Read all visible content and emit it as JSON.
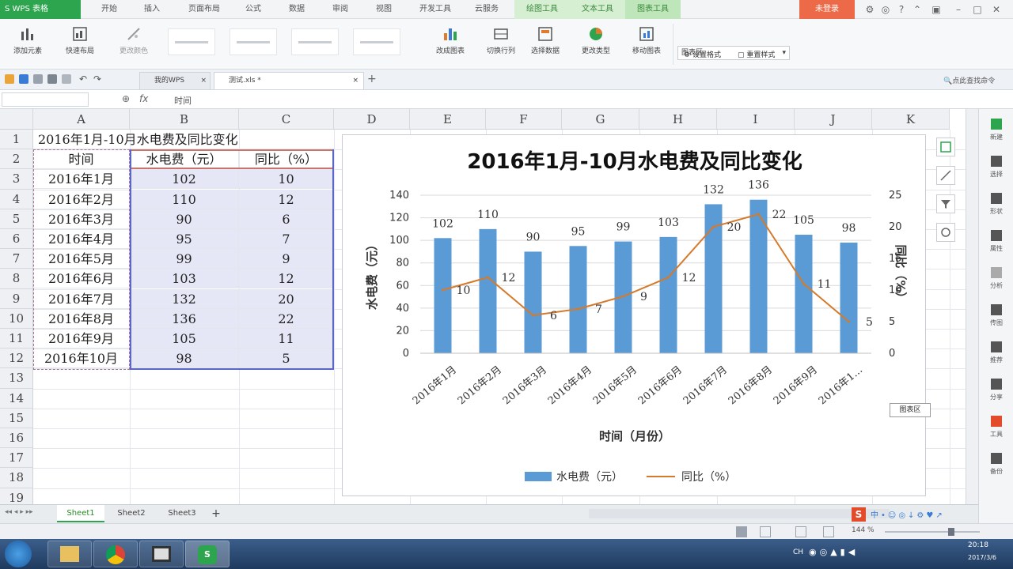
{
  "titlebar": {
    "app_button": "S WPS 表格",
    "tabs": [
      "开始",
      "插入",
      "页面布局",
      "公式",
      "数据",
      "审阅",
      "视图",
      "开发工具",
      "云服务"
    ],
    "context_tabs": [
      "绘图工具",
      "文本工具",
      "图表工具"
    ],
    "login": "未登录"
  },
  "ribbon": {
    "left_buttons": [
      "添加元素",
      "快速布局",
      "更改颜色"
    ],
    "right_buttons": [
      "改成图表",
      "切换行列",
      "选择数据",
      "更改类型",
      "移动图表"
    ],
    "element_select": "图表区",
    "format_buttons": [
      "设置格式",
      "重置样式"
    ]
  },
  "quickbar": {
    "tab1": "我的WPS",
    "tab2": "测试.xls *",
    "search": "点此查找命令"
  },
  "formula": {
    "fx": "fx",
    "content": "时间"
  },
  "sheet": {
    "col_headers": [
      "A",
      "B",
      "C",
      "D",
      "E",
      "F",
      "G",
      "H",
      "I",
      "J",
      "K"
    ],
    "row_numbers": [
      "1",
      "2",
      "3",
      "4",
      "5",
      "6",
      "7",
      "8",
      "9",
      "10",
      "11",
      "12",
      "13",
      "14",
      "15",
      "16",
      "17",
      "18",
      "19"
    ],
    "title_cell": "2016年1月-10月水电费及同比变化",
    "headers": [
      "时间",
      "水电费（元）",
      "同比（%）"
    ],
    "rows": [
      [
        "2016年1月",
        "102",
        "10"
      ],
      [
        "2016年2月",
        "110",
        "12"
      ],
      [
        "2016年3月",
        "90",
        "6"
      ],
      [
        "2016年4月",
        "95",
        "7"
      ],
      [
        "2016年5月",
        "99",
        "9"
      ],
      [
        "2016年6月",
        "103",
        "12"
      ],
      [
        "2016年7月",
        "132",
        "20"
      ],
      [
        "2016年8月",
        "136",
        "22"
      ],
      [
        "2016年9月",
        "105",
        "11"
      ],
      [
        "2016年10月",
        "98",
        "5"
      ]
    ]
  },
  "chart_data": {
    "type": "bar",
    "title": "2016年1月-10月水电费及同比变化",
    "categories": [
      "2016年1月",
      "2016年2月",
      "2016年3月",
      "2016年4月",
      "2016年5月",
      "2016年6月",
      "2016年7月",
      "2016年8月",
      "2016年9月",
      "2016年1…"
    ],
    "series": [
      {
        "name": "水电费（元）",
        "type": "bar",
        "axis": "left",
        "values": [
          102,
          110,
          90,
          95,
          99,
          103,
          132,
          136,
          105,
          98
        ]
      },
      {
        "name": "同比（%）",
        "type": "line",
        "axis": "right",
        "values": [
          10,
          12,
          6,
          7,
          9,
          12,
          20,
          22,
          11,
          5
        ]
      }
    ],
    "xlabel": "时间（月份）",
    "ylabel": "水电费（元）",
    "y2label": "同比（%）",
    "ylim": [
      0,
      140
    ],
    "yticks": [
      "0",
      "20",
      "40",
      "60",
      "80",
      "100",
      "120",
      "140"
    ],
    "y2lim": [
      0,
      25
    ],
    "y2ticks": [
      "0",
      "5",
      "10",
      "15",
      "20",
      "25"
    ],
    "grid": true,
    "legend": "bottom",
    "colors": {
      "bar": "#5b9bd5",
      "line": "#d57a2b"
    }
  },
  "chart_tooltip": "图表区",
  "sheets": {
    "tabs": [
      "Sheet1",
      "Sheet2",
      "Sheet3"
    ],
    "add": "+"
  },
  "status": {
    "zoom": "144 %"
  },
  "right_panel": [
    "新建",
    "选择",
    "形状",
    "属性",
    "分析",
    "传图",
    "推荐",
    "分享",
    "工具",
    "备份"
  ],
  "taskbar": {
    "clock_time": "20:18",
    "clock_date": "2017/3/6",
    "ime": "CH"
  }
}
